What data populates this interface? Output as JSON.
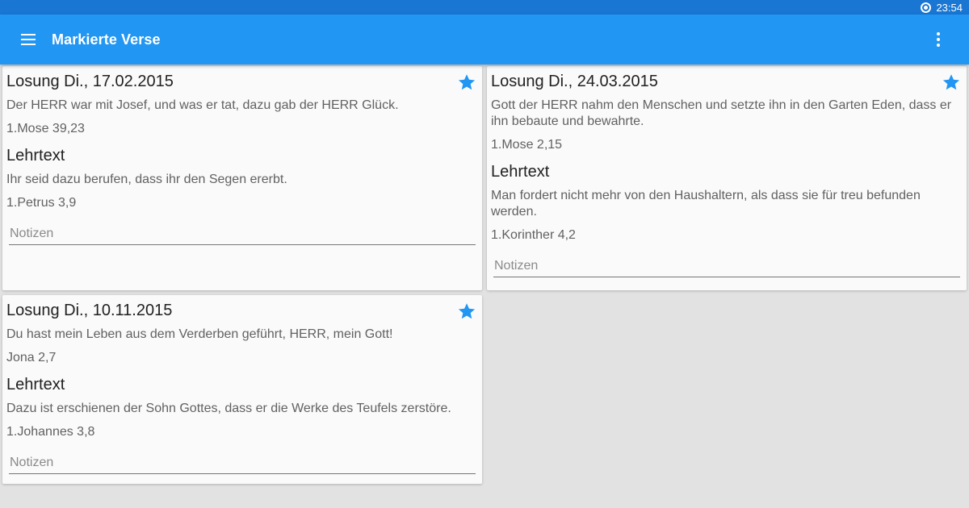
{
  "status_bar": {
    "time": "23:54"
  },
  "app_bar": {
    "title": "Markierte Verse"
  },
  "cards": [
    {
      "title": "Losung Di., 17.02.2015",
      "verse": "Der HERR war mit Josef, und was er tat, dazu gab der HERR Glück.",
      "verse_ref": "1.Mose 39,23",
      "lehrtext_label": "Lehrtext",
      "lehrtext": "Ihr seid dazu berufen, dass ihr den Segen ererbt.",
      "lehrtext_ref": "1.Petrus 3,9",
      "notes_placeholder": "Notizen"
    },
    {
      "title": "Losung Di., 24.03.2015",
      "verse": "Gott der HERR nahm den Menschen und setzte ihn in den Garten Eden, dass er ihn bebaute und bewahrte.",
      "verse_ref": "1.Mose 2,15",
      "lehrtext_label": "Lehrtext",
      "lehrtext": "Man fordert nicht mehr von den Haushaltern, als dass sie für treu befunden werden.",
      "lehrtext_ref": "1.Korinther 4,2",
      "notes_placeholder": "Notizen"
    },
    {
      "title": "Losung Di., 10.11.2015",
      "verse": "Du hast mein Leben aus dem Verderben geführt, HERR, mein Gott!",
      "verse_ref": "Jona 2,7",
      "lehrtext_label": "Lehrtext",
      "lehrtext": "Dazu ist erschienen der Sohn Gottes, dass er die Werke des Teufels zerstöre.",
      "lehrtext_ref": "1.Johannes 3,8",
      "notes_placeholder": "Notizen"
    }
  ],
  "colors": {
    "primary": "#2196f3",
    "primary_dark": "#1976d2",
    "star": "#2196f3"
  },
  "icons": {
    "menu": "hamburger-menu-icon",
    "overflow": "more-vert-icon",
    "star": "star-icon"
  }
}
